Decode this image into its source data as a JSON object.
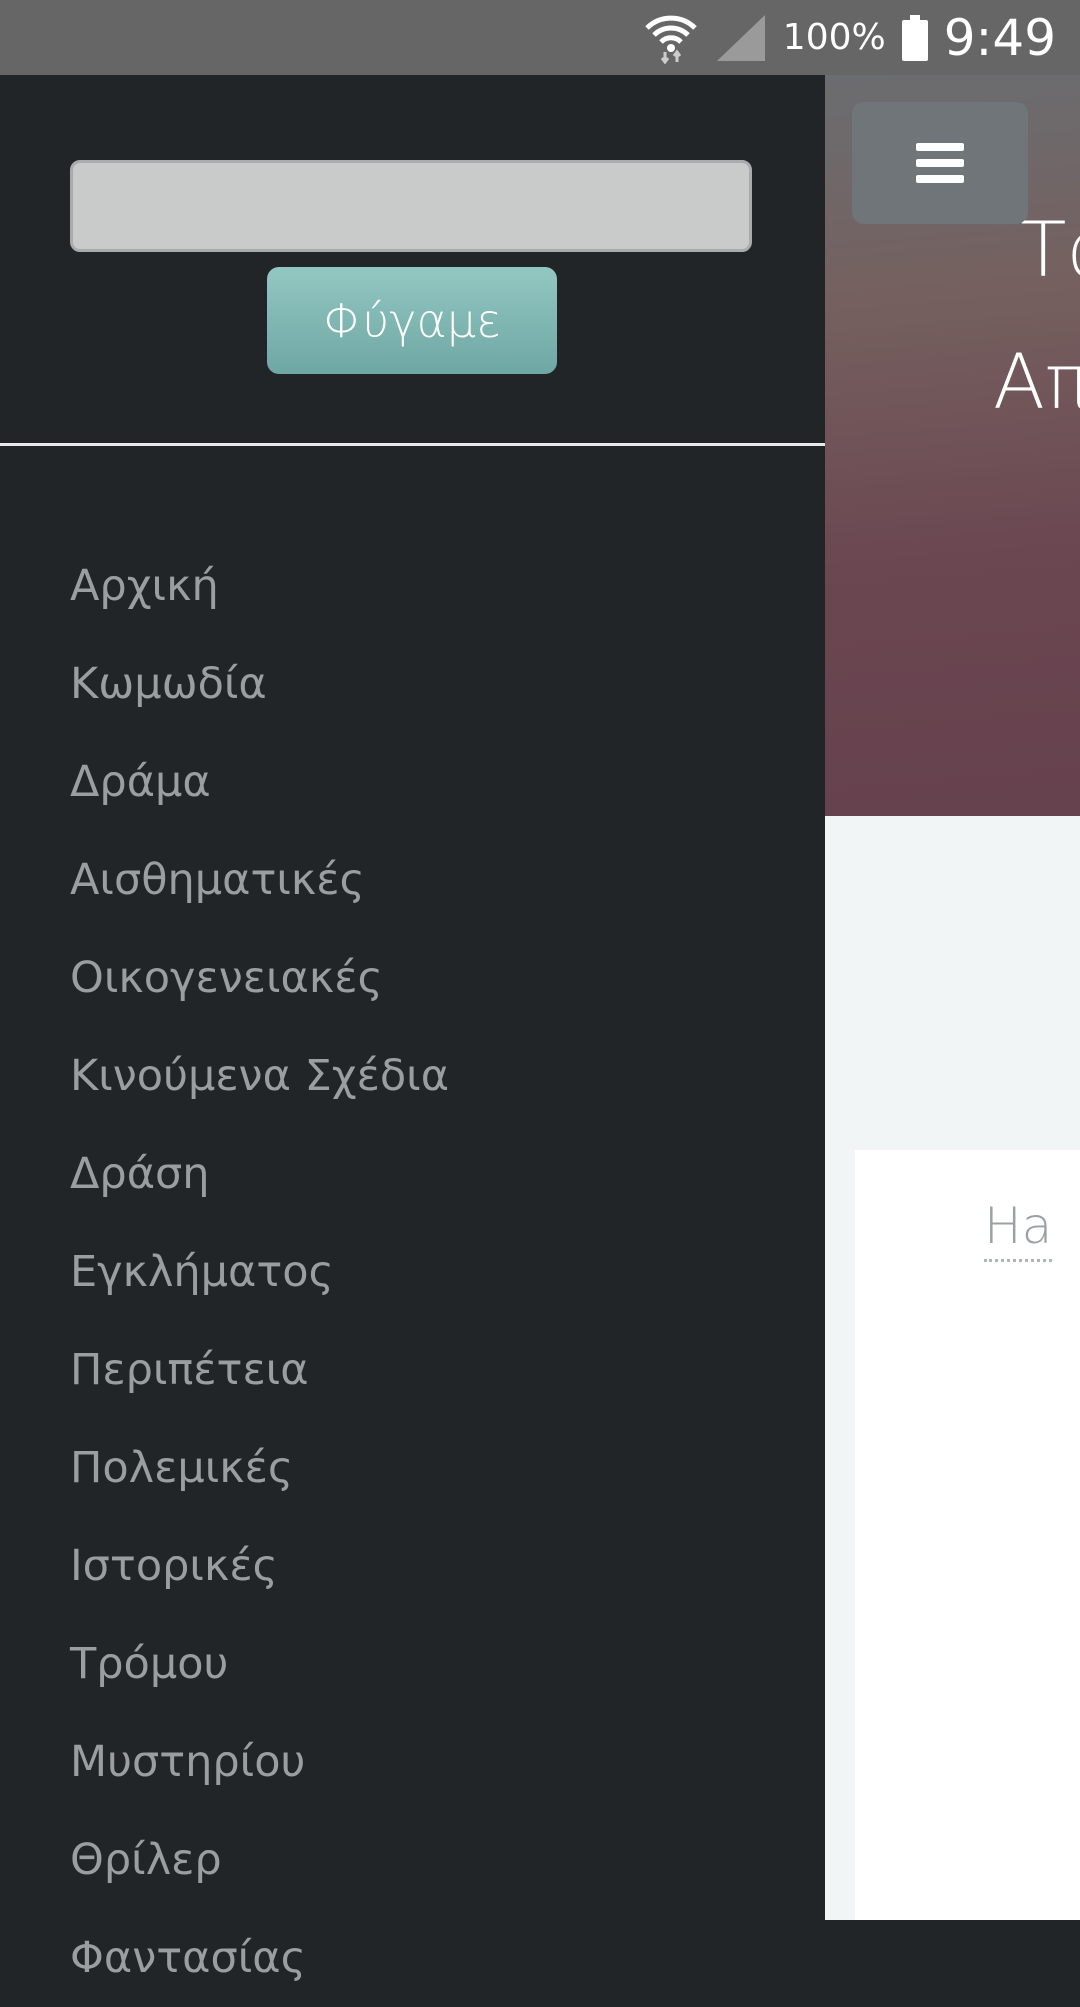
{
  "status_bar": {
    "battery_percent": "100%",
    "time": "9:49",
    "icons": [
      "wifi-icon",
      "cell-signal-icon",
      "battery-icon"
    ]
  },
  "drawer": {
    "search_value": "",
    "search_button_label": "Φύγαμε",
    "menu_items": [
      "Αρχική",
      "Κωμωδία",
      "Δράμα",
      "Αισθηματικές",
      "Οικογενειακές",
      "Κινούμενα Σχέδια",
      "Δράση",
      "Εγκλήματος",
      "Περιπέτεια",
      "Πολεμικές",
      "Ιστορικές",
      "Τρόμου",
      "Μυστηρίου",
      "Θρίλερ",
      "Φαντασίας"
    ]
  },
  "page": {
    "hero_line1": "Τα",
    "hero_line2": "Απ",
    "card_link": "Ha"
  },
  "colors": {
    "drawer_bg": "#222528",
    "button_accent": "#7fb5b2",
    "status_bar_bg": "#666666"
  }
}
